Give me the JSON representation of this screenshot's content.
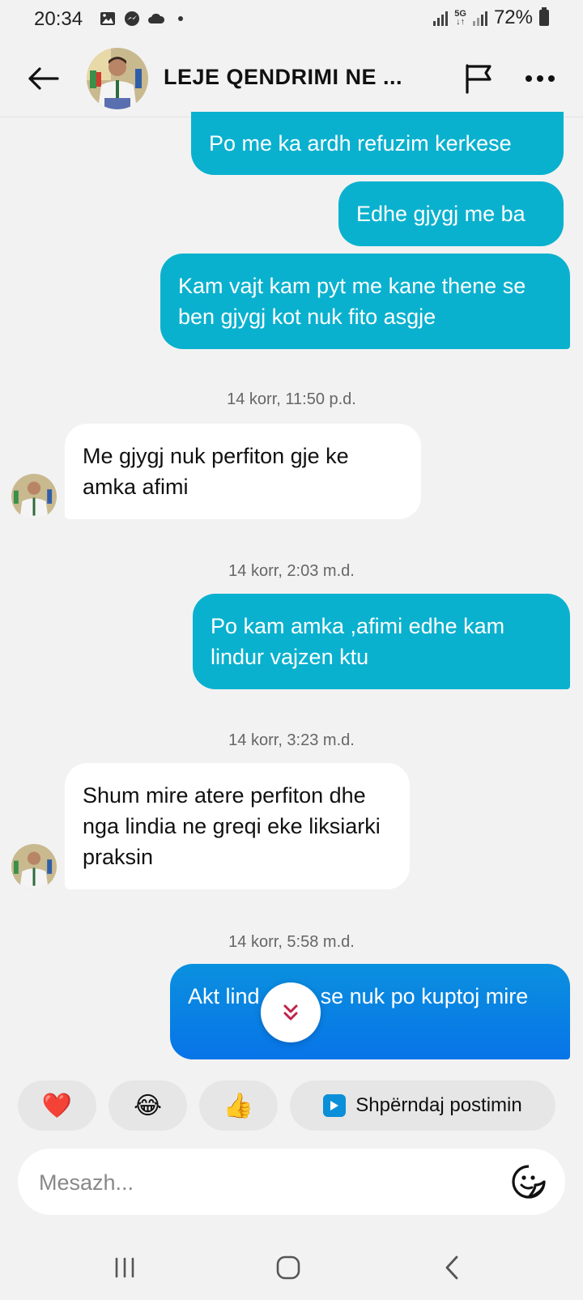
{
  "status_bar": {
    "time": "20:34",
    "network": "5G",
    "battery": "72%",
    "icons": [
      "gallery-icon",
      "messenger-icon",
      "cloud-icon",
      "dot-icon"
    ]
  },
  "header": {
    "title": "LEJE QENDRIMI NE ...",
    "back_icon": "arrow-left-icon",
    "flag_icon": "flag-icon",
    "more_icon": "more-dots-icon"
  },
  "messages": [
    {
      "direction": "out",
      "text": "Po me ka ardh refuzim kerkese"
    },
    {
      "direction": "out",
      "text": "Edhe gjygj me ba"
    },
    {
      "direction": "out",
      "text": "Kam vajt kam pyt me kane thene se ben gjygj kot nuk fito asgje"
    },
    {
      "type": "timestamp",
      "text": "14 korr, 11:50 p.d."
    },
    {
      "direction": "in",
      "text": "Me gjygj nuk perfiton gje ke amka afimi"
    },
    {
      "type": "timestamp",
      "text": "14 korr, 2:03 m.d."
    },
    {
      "direction": "out",
      "text": "Po kam amka ,afimi edhe kam lindur vajzen ktu"
    },
    {
      "type": "timestamp",
      "text": "14 korr, 3:23 m.d."
    },
    {
      "direction": "in",
      "text": "Shum mire atere perfiton dhe nga lindia ne greqi eke liksiarki praksin"
    },
    {
      "type": "timestamp",
      "text": "14 korr, 5:58 m.d."
    },
    {
      "direction": "out",
      "text": "Akt lind   hua se nuk po kuptoj mire"
    }
  ],
  "quick_replies": [
    {
      "emoji": "❤️",
      "icon": "heart-icon"
    },
    {
      "emoji": "😂",
      "icon": "laughing-emoji-icon"
    },
    {
      "emoji": "👍",
      "icon": "thumbs-up-icon"
    },
    {
      "label": "Shpërndaj postimin",
      "icon": "share-post-icon"
    }
  ],
  "input": {
    "placeholder": "Mesazh...",
    "sticker_icon": "sticker-icon"
  },
  "colors": {
    "outgoing_bubble": "#0ab1cf",
    "latest_bubble": "#0a7fe4",
    "incoming_bubble": "#ffffff",
    "background": "#f2f2f2"
  },
  "nav": {
    "icons": [
      "recents-icon",
      "home-icon",
      "back-nav-icon"
    ]
  }
}
